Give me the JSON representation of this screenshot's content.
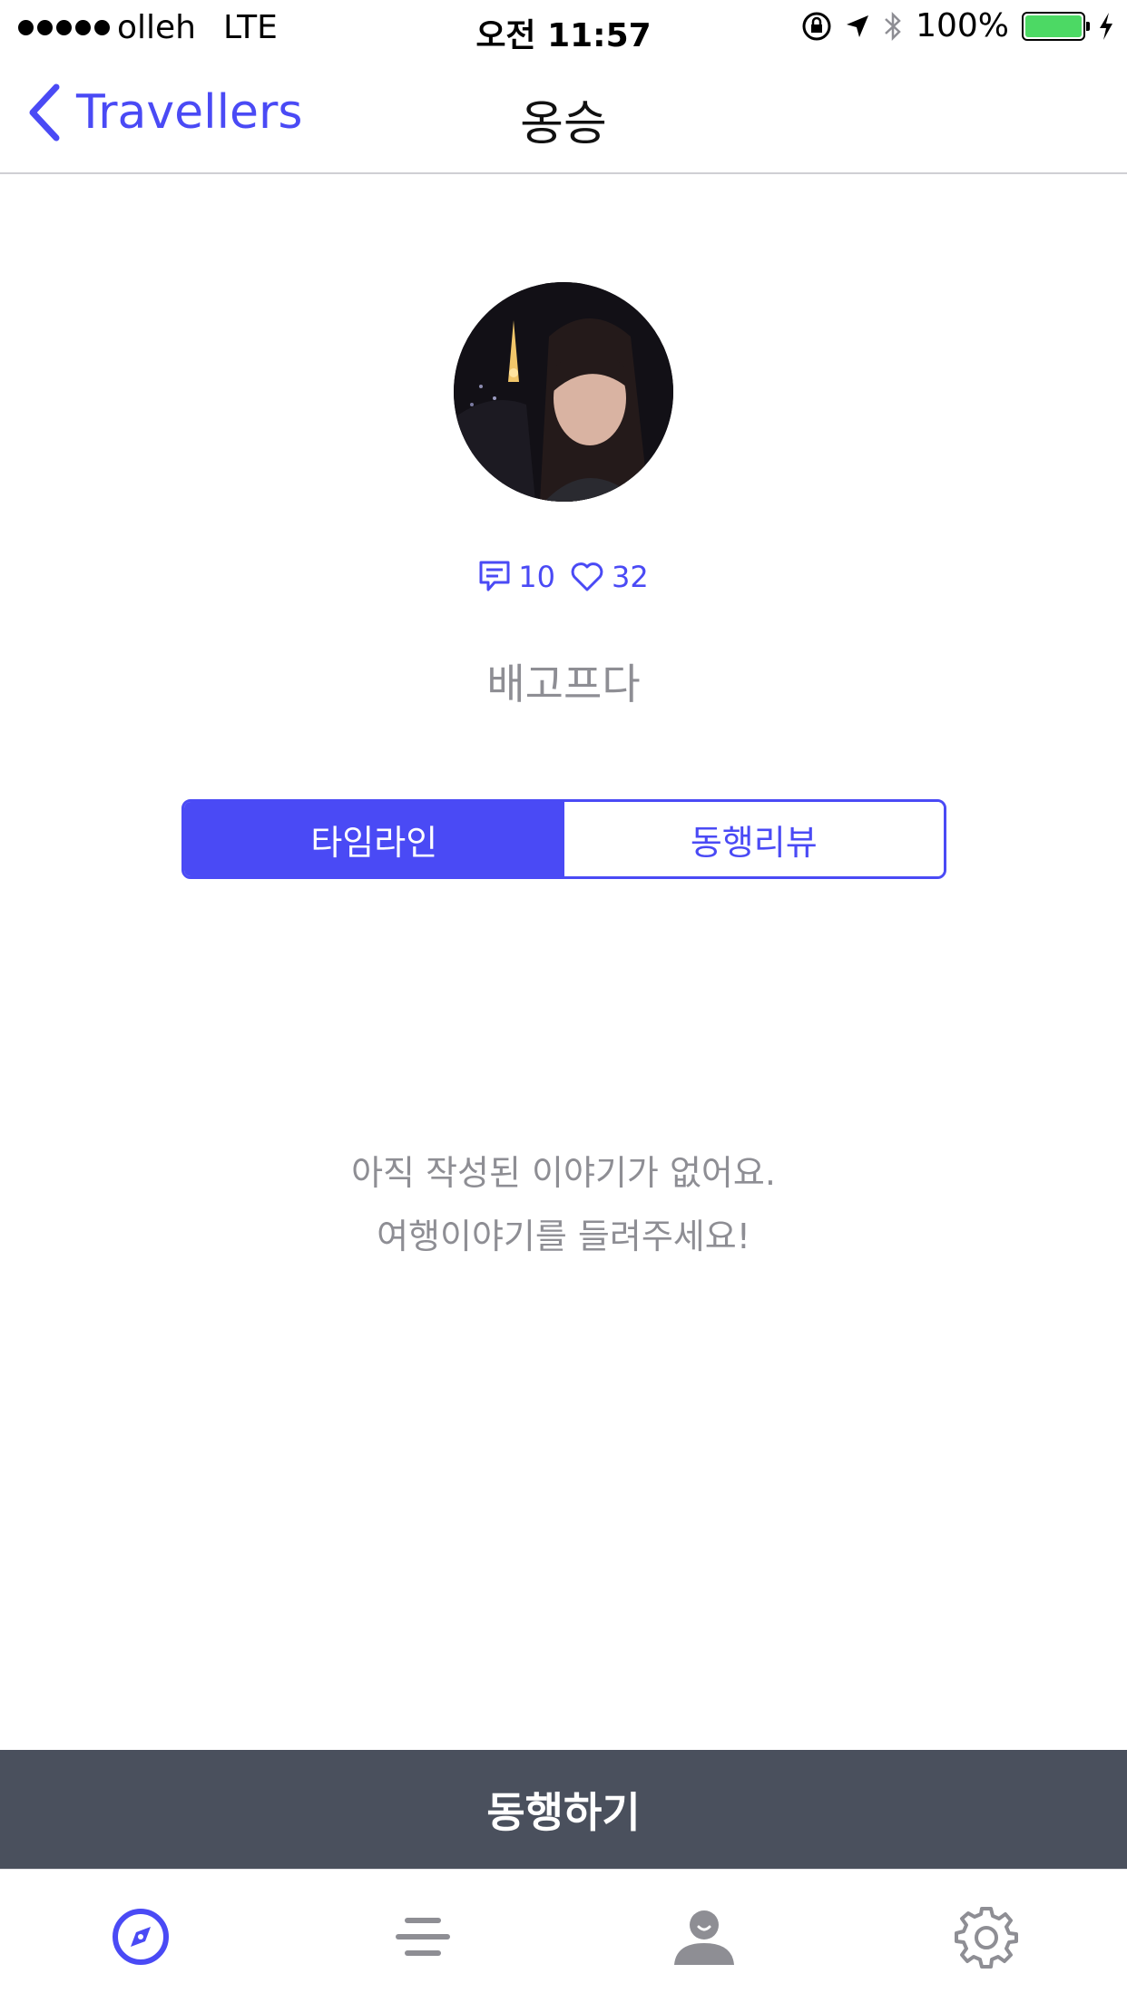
{
  "status_bar": {
    "carrier": "olleh",
    "network": "LTE",
    "time": "오전 11:57",
    "battery": "100%"
  },
  "nav": {
    "back_label": "Travellers",
    "title": "옹승"
  },
  "profile": {
    "comments_count": "10",
    "likes_count": "32",
    "username": "배고프다"
  },
  "segments": {
    "timeline": "타임라인",
    "reviews": "동행리뷰"
  },
  "empty_state": {
    "line1": "아직 작성된 이야기가 없어요.",
    "line2": "여행이야기를 들려주세요!"
  },
  "action": {
    "label": "동행하기"
  },
  "tab_bar": {
    "icons": [
      "compass-icon",
      "menu-icon",
      "profile-icon",
      "gear-icon"
    ],
    "active_color": "#4a4af5",
    "inactive_color": "#8e8e94"
  }
}
